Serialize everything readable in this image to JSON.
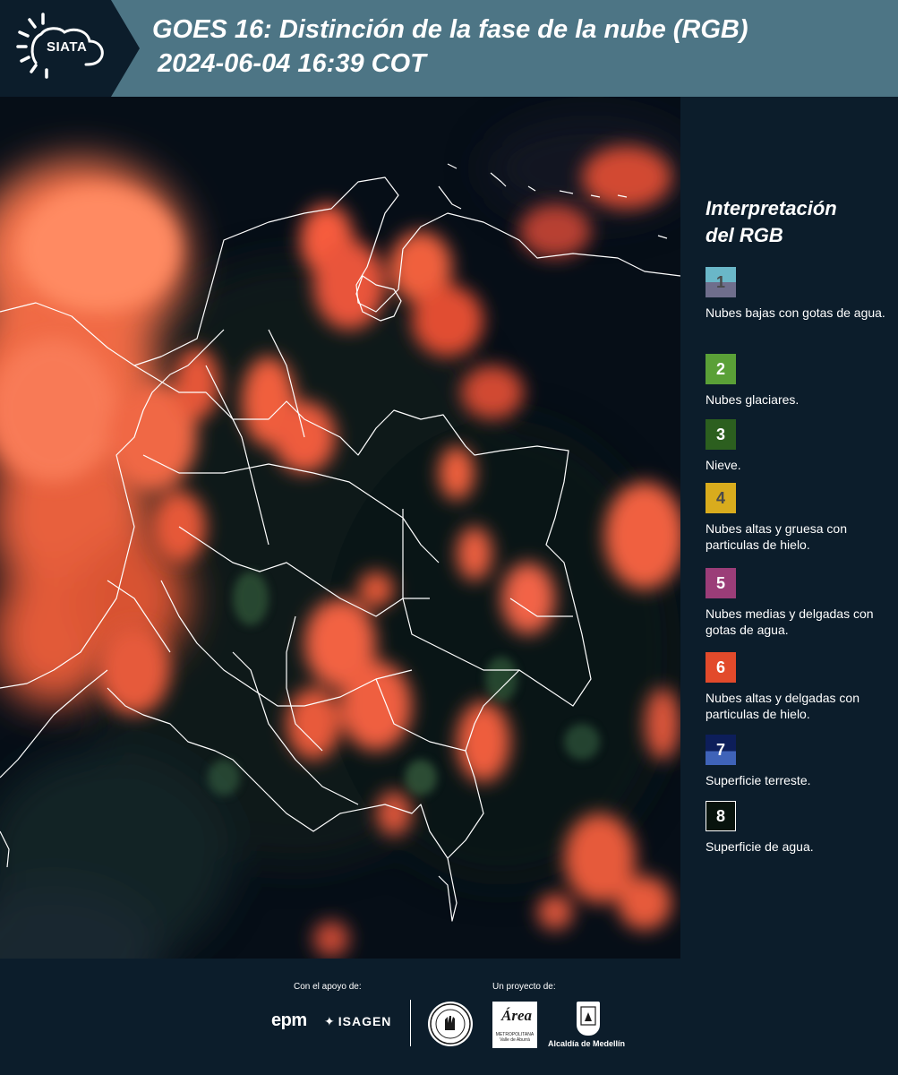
{
  "header": {
    "logo_text": "SIATA",
    "title": "GOES 16: Distinción de la fase de la nube (RGB)",
    "subtitle": "2024-06-04 16:39 COT"
  },
  "legend": {
    "title_line1": "Interpretación",
    "title_line2": "del RGB",
    "items": [
      {
        "number": "1",
        "label": "Nubes bajas con gotas de agua.",
        "colors": [
          "#6ab7c8",
          "#6f6e8c"
        ],
        "number_color": "#4a4a4a"
      },
      {
        "number": "2",
        "label": "Nubes glaciares.",
        "colors": [
          "#5aa037"
        ],
        "number_color": "#ffffff"
      },
      {
        "number": "3",
        "label": "Nieve.",
        "colors": [
          "#2c5f1f"
        ],
        "number_color": "#ffffff"
      },
      {
        "number": "4",
        "label": "Nubes altas y gruesa con particulas de hielo.",
        "colors": [
          "#d9ac1d"
        ],
        "number_color": "#4a4a4a"
      },
      {
        "number": "5",
        "label": "Nubes medias y delgadas con gotas de agua.",
        "colors": [
          "#9b3d78"
        ],
        "number_color": "#ffffff"
      },
      {
        "number": "6",
        "label": "Nubes altas y delgadas con particulas de hielo.",
        "colors": [
          "#e24a2b"
        ],
        "number_color": "#ffffff"
      },
      {
        "number": "7",
        "label": "Superficie terreste.",
        "colors": [
          "#0d1e5a",
          "#3f63b8"
        ],
        "number_color": "#ffffff"
      },
      {
        "number": "8",
        "label": "Superficie de agua.",
        "colors": [
          "#08130d"
        ],
        "number_color": "#ffffff"
      }
    ]
  },
  "footer": {
    "support_label": "Con el apoyo de:",
    "project_label": "Un proyecto de:",
    "sponsor1": "epm",
    "sponsor2": "ISAGEN",
    "area_name": "Área",
    "area_sub": "METROPOLITANA Valle de Aburrá",
    "medellin": "Alcaldía de Medellín"
  }
}
